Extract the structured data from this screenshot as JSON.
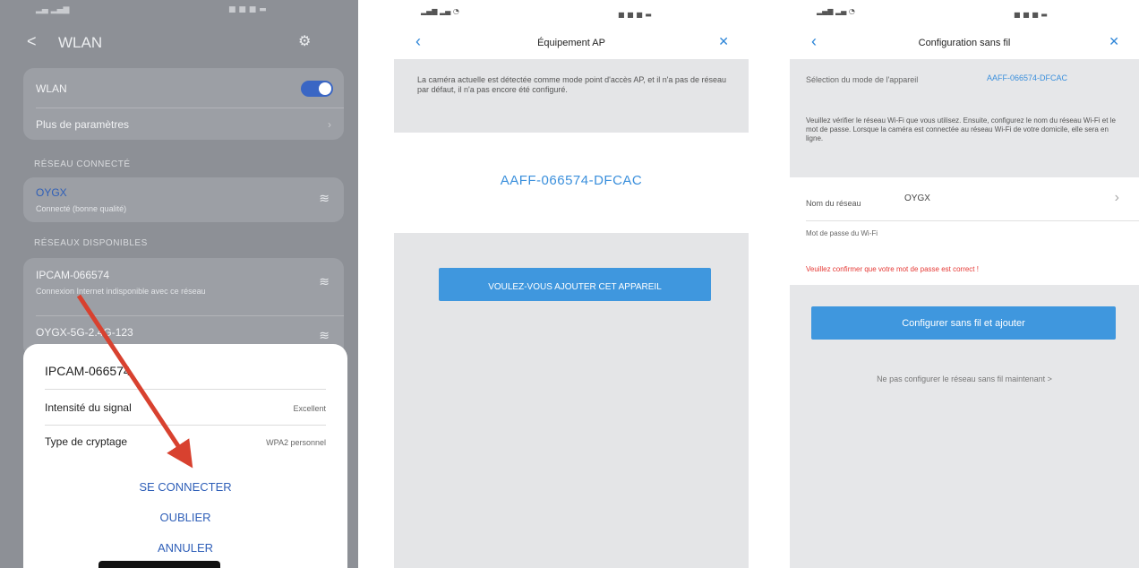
{
  "panel1": {
    "status_left": "▂▄ ▂▄▆",
    "status_right": "■ ■ ■ ▬",
    "header": {
      "back": "<",
      "title": "WLAN",
      "settings_icon": "gear-icon"
    },
    "wlan_row": {
      "label": "WLAN",
      "enabled": true
    },
    "more_row": {
      "label": "Plus de paramètres"
    },
    "section_connected": "RÉSEAU CONNECTÉ",
    "connected": {
      "name": "OYGX",
      "subtitle": "Connecté (bonne qualité)"
    },
    "section_available": "RÉSEAUX DISPONIBLES",
    "networks": [
      {
        "name": "IPCAM-066574",
        "subtitle": "Connexion Internet indisponible avec ce réseau"
      },
      {
        "name": "OYGX-5G-2.4G-123",
        "subtitle": ""
      }
    ],
    "sheet": {
      "title": "IPCAM-066574",
      "rows": [
        {
          "label": "Intensité du signal",
          "value": "Excellent"
        },
        {
          "label": "Type de cryptage",
          "value": "WPA2 personnel"
        }
      ],
      "buttons": {
        "connect": "SE CONNECTER",
        "forget": "OUBLIER",
        "cancel": "ANNULER"
      }
    }
  },
  "panel2": {
    "status_left": "▂▄▆ ▂▄ ◔",
    "status_right": "■ ■ ■ ▬",
    "title": "Équipement AP",
    "info": "La caméra actuelle est détectée comme mode point d'accès AP, et il n'a pas de réseau par défaut, il n'a pas encore été configuré.",
    "device_id": "AAFF-066574-DFCAC",
    "button": "VOULEZ-VOUS AJOUTER CET APPAREIL"
  },
  "panel3": {
    "status_left": "▂▄▆ ▂▄ ◔",
    "status_right": "■ ■ ■ ▬",
    "title": "Configuration sans fil",
    "mode_label": "Sélection du mode de l'appareil",
    "mode_value": "AAFF-066574-DFCAC",
    "description": "Veuillez vérifier le réseau Wi-Fi que vous utilisez. Ensuite, configurez le nom du réseau Wi-Fi et le mot de passe. Lorsque la caméra est connectée au réseau Wi-Fi de votre domicile, elle sera en ligne.",
    "network_label": "Nom du réseau",
    "network_value": "OYGX",
    "password_label": "Mot de passe du Wi-Fi",
    "warning": "Veuillez confirmer que votre mot de passe est correct !",
    "button": "Configurer sans fil et ajouter",
    "link": "Ne pas configurer le réseau sans fil maintenant >"
  }
}
